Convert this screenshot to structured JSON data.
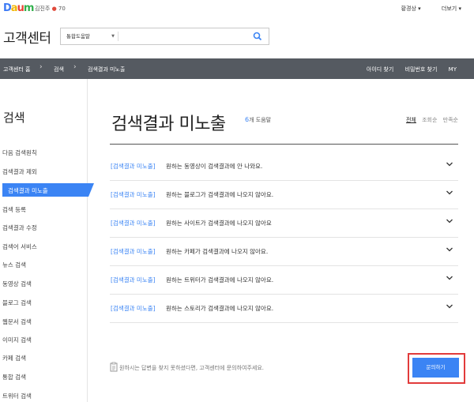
{
  "topbar": {
    "logo": "Daum",
    "user_name": "김진주",
    "user_points": "70",
    "links": [
      "황경상",
      "더보기"
    ]
  },
  "header": {
    "title": "고객센터",
    "search": {
      "selected": "통합도움말",
      "value": ""
    }
  },
  "breadcrumb": [
    "고객센터 홈",
    "검색",
    "검색결과 미노출"
  ],
  "darkbar_links": [
    "아이디 찾기",
    "비밀번호 찾기",
    "MY"
  ],
  "sidebar": {
    "title": "검색",
    "items": [
      "다음 검색원칙",
      "검색결과 제외",
      "검색결과 미노출",
      "검색 등록",
      "검색결과 수정",
      "검색어 서비스",
      "뉴스 검색",
      "동영상 검색",
      "블로그 검색",
      "웹문서 검색",
      "이미지 검색",
      "카페 검색",
      "통합 검색",
      "트위터 검색"
    ],
    "active_index": 2
  },
  "main": {
    "title": "검색결과 미노출",
    "count": "6",
    "count_suffix": "개 도움말",
    "sort": [
      "전체",
      "조회순",
      "만족순"
    ],
    "rows": [
      {
        "tag": "[검색결과 미노출]",
        "text": "원하는 동영상이 검색결과에 안 나와요."
      },
      {
        "tag": "[검색결과 미노출]",
        "text": "원하는 블로그가 검색결과에 나오지 않아요."
      },
      {
        "tag": "[검색결과 미노출]",
        "text": "원하는 사이트가 검색결과에 나오지 않아요"
      },
      {
        "tag": "[검색결과 미노출]",
        "text": "원하는 카페가 검색결과에 나오지 않아요."
      },
      {
        "tag": "[검색결과 미노출]",
        "text": "원하는 트위터가 검색결과에 나오지 않아요."
      },
      {
        "tag": "[검색결과 미노출]",
        "text": "원하는 스토리가 검색결과에 나오지 않아요."
      }
    ],
    "notice": "원하시는 답변을 찾지 못하셨다면, 고객센터에 문의하여주세요.",
    "inquire_label": "문의하기"
  },
  "colors": {
    "accent": "#3b84f4",
    "darkbar": "#555a61",
    "highlight": "#e23b3b"
  }
}
